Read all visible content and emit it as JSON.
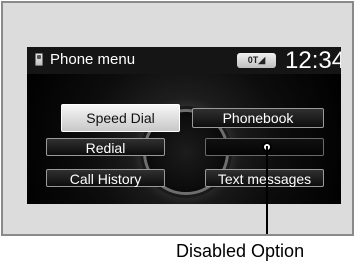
{
  "header": {
    "title": "Phone menu",
    "signal_badge": "0T◢",
    "time": "12:34"
  },
  "menu": {
    "speed_dial": "Speed Dial",
    "phonebook": "Phonebook",
    "redial": "Redial",
    "call_history": "Call History",
    "text_messages": "Text messages"
  },
  "annotation": {
    "label": "Disabled Option"
  },
  "icons": {
    "phone": "phone-icon"
  },
  "colors": {
    "screen_bg": "#000000",
    "button_text": "#ffffff",
    "selected_bg": "#f1f1f1",
    "frame_bg": "#dcdcdc"
  }
}
